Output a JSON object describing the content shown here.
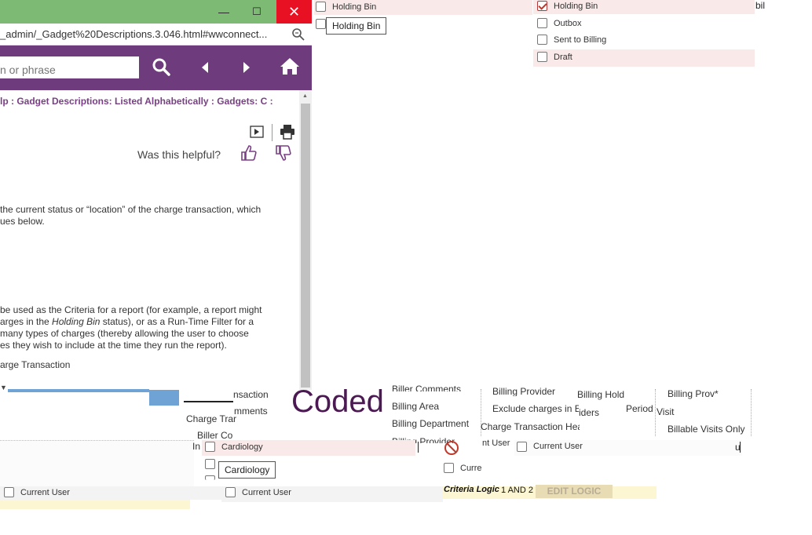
{
  "window": {
    "minimize_glyph": "—",
    "maximize_glyph": "☐",
    "close_glyph": "✕",
    "address": "_admin/_Gadget%20Descriptions.3.046.html#wwconnect..."
  },
  "help": {
    "search_placeholder": "n or phrase",
    "breadcrumb": "lp : Gadget Descriptions: Listed Alphabetically : Gadgets: C :",
    "helpful_question": "Was this helpful?",
    "paragraph1": [
      "the current status or “location” of the charge transaction, which",
      "ues below."
    ],
    "paragraph2": [
      "be used as the Criteria for a report (for example, a report might",
      "arges in the ",
      "Holding Bin",
      " status), or as a Run-Time Filter for a",
      "many types of charges (thereby allowing the user to choose",
      "es they wish to include at the time they run the report)."
    ],
    "paragraph3": "arge Transaction"
  },
  "top_list_left": {
    "items": [
      {
        "label": "Holding Bin",
        "checked": false
      },
      {
        "label": "",
        "checked": false
      }
    ],
    "tooltip": "Holding Bin"
  },
  "top_list_right": {
    "items": [
      {
        "label": "Holding Bin",
        "checked": true
      },
      {
        "label": "Outbox",
        "checked": false
      },
      {
        "label": "Sent to Billing",
        "checked": false
      },
      {
        "label": "Draft",
        "checked": false
      }
    ],
    "corner_text": "bil"
  },
  "gadget_strip": {
    "col1": [
      "nsaction",
      "mments",
      "Charge Trar",
      "Biller Co"
    ],
    "coded": "Coded",
    "col3": [
      "Biller Comments",
      "Billing Area",
      "Billing Department",
      "Billing Provider"
    ],
    "col4": [
      "Billing Provider",
      "Exclude charges in E",
      "Charge Transaction Hea"
    ],
    "col5": [
      "Billing Hold",
      "iders",
      "Period"
    ],
    "col6": [
      "Billing Prov*",
      "Visit",
      "Billable Visits Only"
    ]
  },
  "lower": {
    "cardiology_label": "Cardiology",
    "cardiology_tooltip": "Cardiology",
    "current_user_1": "Current User",
    "current_user_2": "Current User",
    "current_user_3": "Current User",
    "current_user_4": "Curre",
    "nt_user": "nt User",
    "criteria_logic_label": "Criteria Logic",
    "criteria_logic_value": "1 AND 2",
    "edit_logic": "EDIT LOGIC",
    "stray_u": "u",
    "stray_in": "In"
  },
  "colors": {
    "titlebar": "#7dbb74",
    "help_toolbar": "#6e3b7d",
    "close": "#e81123",
    "coded_text": "#4b1a52",
    "highlight_row": "#f9e9e8"
  }
}
